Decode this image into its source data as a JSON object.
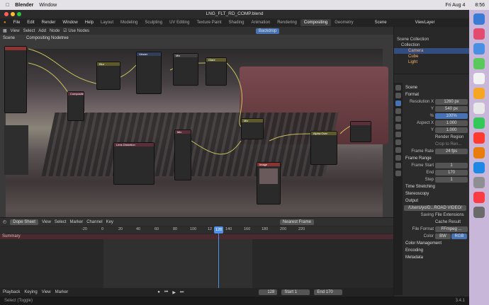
{
  "mac": {
    "apple": "",
    "app": "Blender",
    "menu": "Window",
    "date": "Fri Aug 4",
    "time": "8:56"
  },
  "window_title": "LNG_FLT_RD_COMP.blend",
  "workspaces": {
    "menus": [
      "File",
      "Edit",
      "Render",
      "Window",
      "Help"
    ],
    "tabs": [
      "Layout",
      "Modeling",
      "Sculpting",
      "UV Editing",
      "Texture Paint",
      "Shading",
      "Animation",
      "Rendering",
      "Compositing",
      "Geometry"
    ],
    "active": "Compositing",
    "scene": "Scene",
    "viewlayer": "ViewLayer"
  },
  "node_header": {
    "items": [
      "View",
      "Select",
      "Add",
      "Node"
    ],
    "use_nodes": "Use Nodes",
    "backdrop": "Backdrop"
  },
  "breadcrumb": {
    "scene": "Scene",
    "tree": "Compositing Nodetree"
  },
  "nodes": [
    {
      "title": "Blur"
    },
    {
      "title": "Viewer"
    },
    {
      "title": "Mix"
    },
    {
      "title": "Glare"
    },
    {
      "title": "Composite"
    },
    {
      "title": "Lens Distortion"
    },
    {
      "title": "Mix"
    },
    {
      "title": "Mix"
    },
    {
      "title": "Alpha Over"
    },
    {
      "title": "Image"
    }
  ],
  "dope": {
    "mode": "Dope Sheet",
    "menus": [
      "View",
      "Select",
      "Marker",
      "Channel",
      "Key"
    ],
    "interp": "Nearest Frame",
    "summary": "Summary",
    "ticks": [
      "-20",
      "0",
      "20",
      "40",
      "60",
      "80",
      "100",
      "12",
      "140",
      "160",
      "180",
      "200",
      "220"
    ],
    "current": "128"
  },
  "status": {
    "playback": "Playback",
    "keying": "Keying",
    "view": "View",
    "marker": "Marker",
    "frame": "128",
    "start_label": "Start",
    "start": "1",
    "end_label": "End",
    "end": "170"
  },
  "bottom": {
    "left": "Select (Toggle)",
    "right": "3.4.1"
  },
  "outliner": {
    "title": "Scene Collection",
    "items": [
      "Collection",
      "Camera",
      "Cube",
      "Light"
    ]
  },
  "props": {
    "scene": "Scene",
    "format": "Format",
    "res_x_label": "Resolution X",
    "res_x": "1260 px",
    "res_y_label": "Y",
    "res_y": "540 px",
    "pct_label": "%",
    "pct": "100%",
    "aspect_x_label": "Aspect X",
    "aspect_x": "1.000",
    "aspect_y_label": "Y",
    "aspect_y": "1.000",
    "render_region": "Render Region",
    "crop": "Crop to Ren...",
    "fps_label": "Frame Rate",
    "fps": "24 fps",
    "frame_range": "Frame Range",
    "fstart_label": "Frame Start",
    "fstart": "1",
    "fend_label": "End",
    "fend": "170",
    "step_label": "Step",
    "step": "1",
    "time_stretching": "Time Stretching",
    "stereoscopy": "Stereoscopy",
    "output": "Output",
    "path": "/Users/yo/D...ROAD VIDEO/",
    "saving_label": "Saving",
    "file_ext": "File Extensions",
    "cache": "Cache Result",
    "ff_label": "File Format",
    "ff": "FFmpeg ...",
    "color_label": "Color",
    "bw": "BW",
    "rgb": "RGB",
    "color_mgmt": "Color Management",
    "encoding": "Encoding",
    "metadata": "Metadata"
  }
}
